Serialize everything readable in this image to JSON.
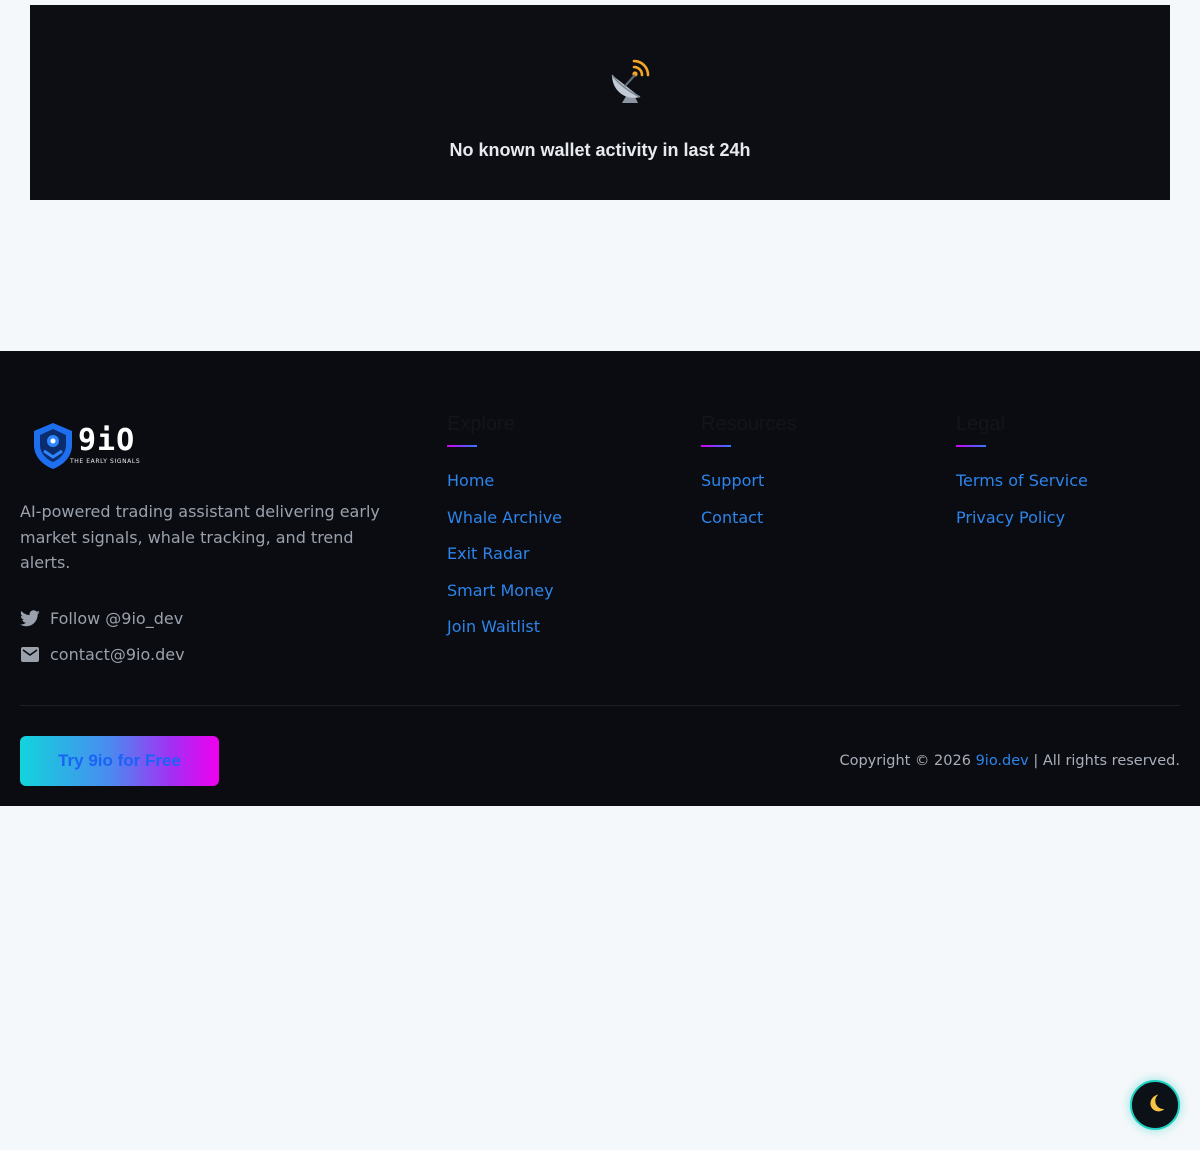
{
  "empty_state": {
    "icon": "satellite-dish-icon",
    "message": "No known wallet activity in last 24h"
  },
  "footer": {
    "brand": {
      "logo_text": "9iO",
      "tagline": "THE EARLY SIGNALS",
      "description": "AI-powered trading assistant delivering early market signals, whale tracking, and trend alerts.",
      "follow_text": "Follow @9io_dev",
      "email_text": "contact@9io.dev"
    },
    "columns": {
      "explore": {
        "title": "Explore",
        "links": [
          "Home",
          "Whale Archive",
          "Exit Radar",
          "Smart Money",
          "Join Waitlist"
        ]
      },
      "resources": {
        "title": "Resources",
        "links": [
          "Support",
          "Contact"
        ]
      },
      "legal": {
        "title": "Legal",
        "links": [
          "Terms of Service",
          "Privacy Policy"
        ]
      }
    },
    "cta_label": "Try 9io for Free",
    "copyright": {
      "prefix": "Copyright © 2026 ",
      "site": "9io.dev",
      "suffix": " | All rights reserved."
    }
  },
  "theme_toggle": {
    "icon": "moon-icon"
  },
  "colors": {
    "page_bg": "#f5f8fb",
    "card_bg": "#0c0e13",
    "footer_bg": "#0a0c11",
    "link": "#2d84ea",
    "muted_text": "#9aa1ac",
    "cta_gradient_start": "#12d4dc",
    "cta_gradient_end": "#f000ee",
    "toggle_ring": "#1fd1c2"
  }
}
